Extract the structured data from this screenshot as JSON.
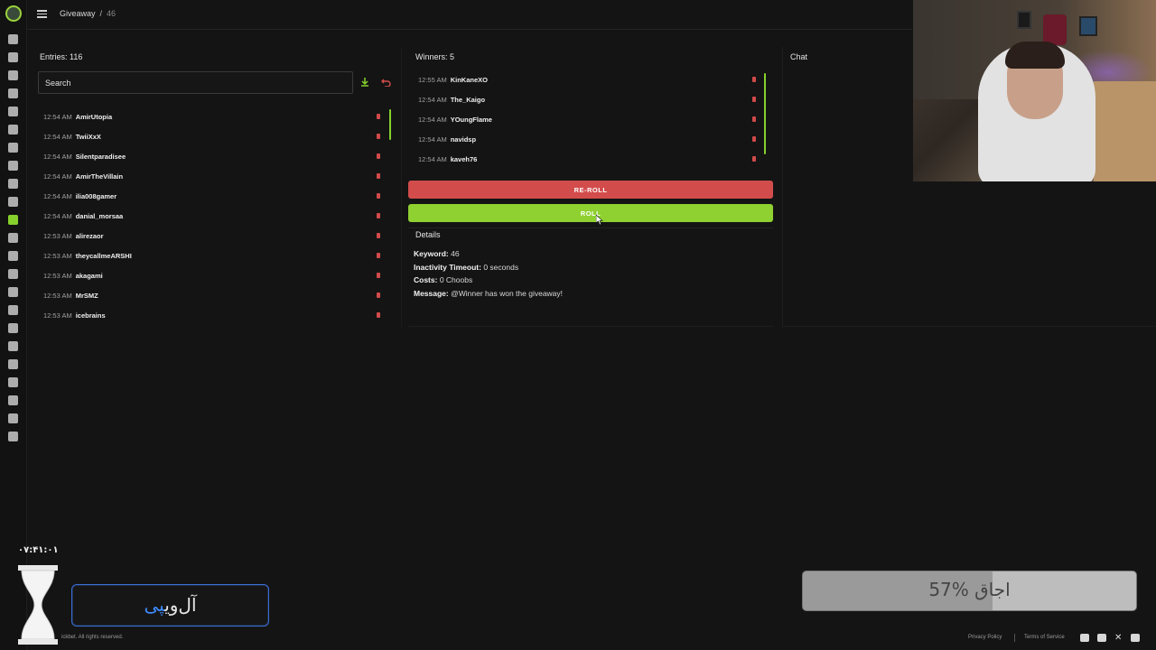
{
  "breadcrumb": {
    "section": "Giveaway",
    "separator": "/",
    "keyword": "46"
  },
  "entries": {
    "title": "Entries: 116",
    "search_placeholder": "Search",
    "rows": [
      {
        "time": "12:54 AM",
        "name": "AmirUtopia"
      },
      {
        "time": "12:54 AM",
        "name": "TwiiXxX"
      },
      {
        "time": "12:54 AM",
        "name": "Silentparadisee"
      },
      {
        "time": "12:54 AM",
        "name": "AmirTheVillain"
      },
      {
        "time": "12:54 AM",
        "name": "ilia008gamer"
      },
      {
        "time": "12:54 AM",
        "name": "danial_morsaa"
      },
      {
        "time": "12:53 AM",
        "name": "alirezaor"
      },
      {
        "time": "12:53 AM",
        "name": "theycallmeARSHI"
      },
      {
        "time": "12:53 AM",
        "name": "akagami"
      },
      {
        "time": "12:53 AM",
        "name": "MrSMZ"
      },
      {
        "time": "12:53 AM",
        "name": "icebrains"
      }
    ]
  },
  "winners": {
    "title": "Winners: 5",
    "rows": [
      {
        "time": "12:55 AM",
        "name": "KinKaneXO"
      },
      {
        "time": "12:54 AM",
        "name": "The_Kaigo"
      },
      {
        "time": "12:54 AM",
        "name": "YOungFlame"
      },
      {
        "time": "12:54 AM",
        "name": "navidsp"
      },
      {
        "time": "12:54 AM",
        "name": "kaveh76"
      }
    ],
    "reroll_label": "RE-ROLL",
    "roll_label": "ROLL"
  },
  "details": {
    "title": "Details",
    "keyword_label": "Keyword:",
    "keyword_value": " 46",
    "timeout_label": "Inactivity Timeout:",
    "timeout_value": " 0 seconds",
    "costs_label": "Costs:",
    "costs_value": " 0 Choobs",
    "message_label": "Message:",
    "message_value": " @Winner has won the giveaway!"
  },
  "chat": {
    "title": "Chat"
  },
  "overlay": {
    "timer": "۰۷:۴۱:۰۱",
    "brand_main": "آل‌وی",
    "brand_accent": "پی",
    "progress_label": "57% اجاق",
    "progress_percent": 57
  },
  "footer": {
    "copyright": "ickbet. All rights reserved.",
    "privacy": "Privacy Policy",
    "terms": "Terms of Service"
  },
  "colors": {
    "accent_green": "#86d12c",
    "danger_red": "#d34c4c",
    "brand_blue": "#3e8cff"
  }
}
